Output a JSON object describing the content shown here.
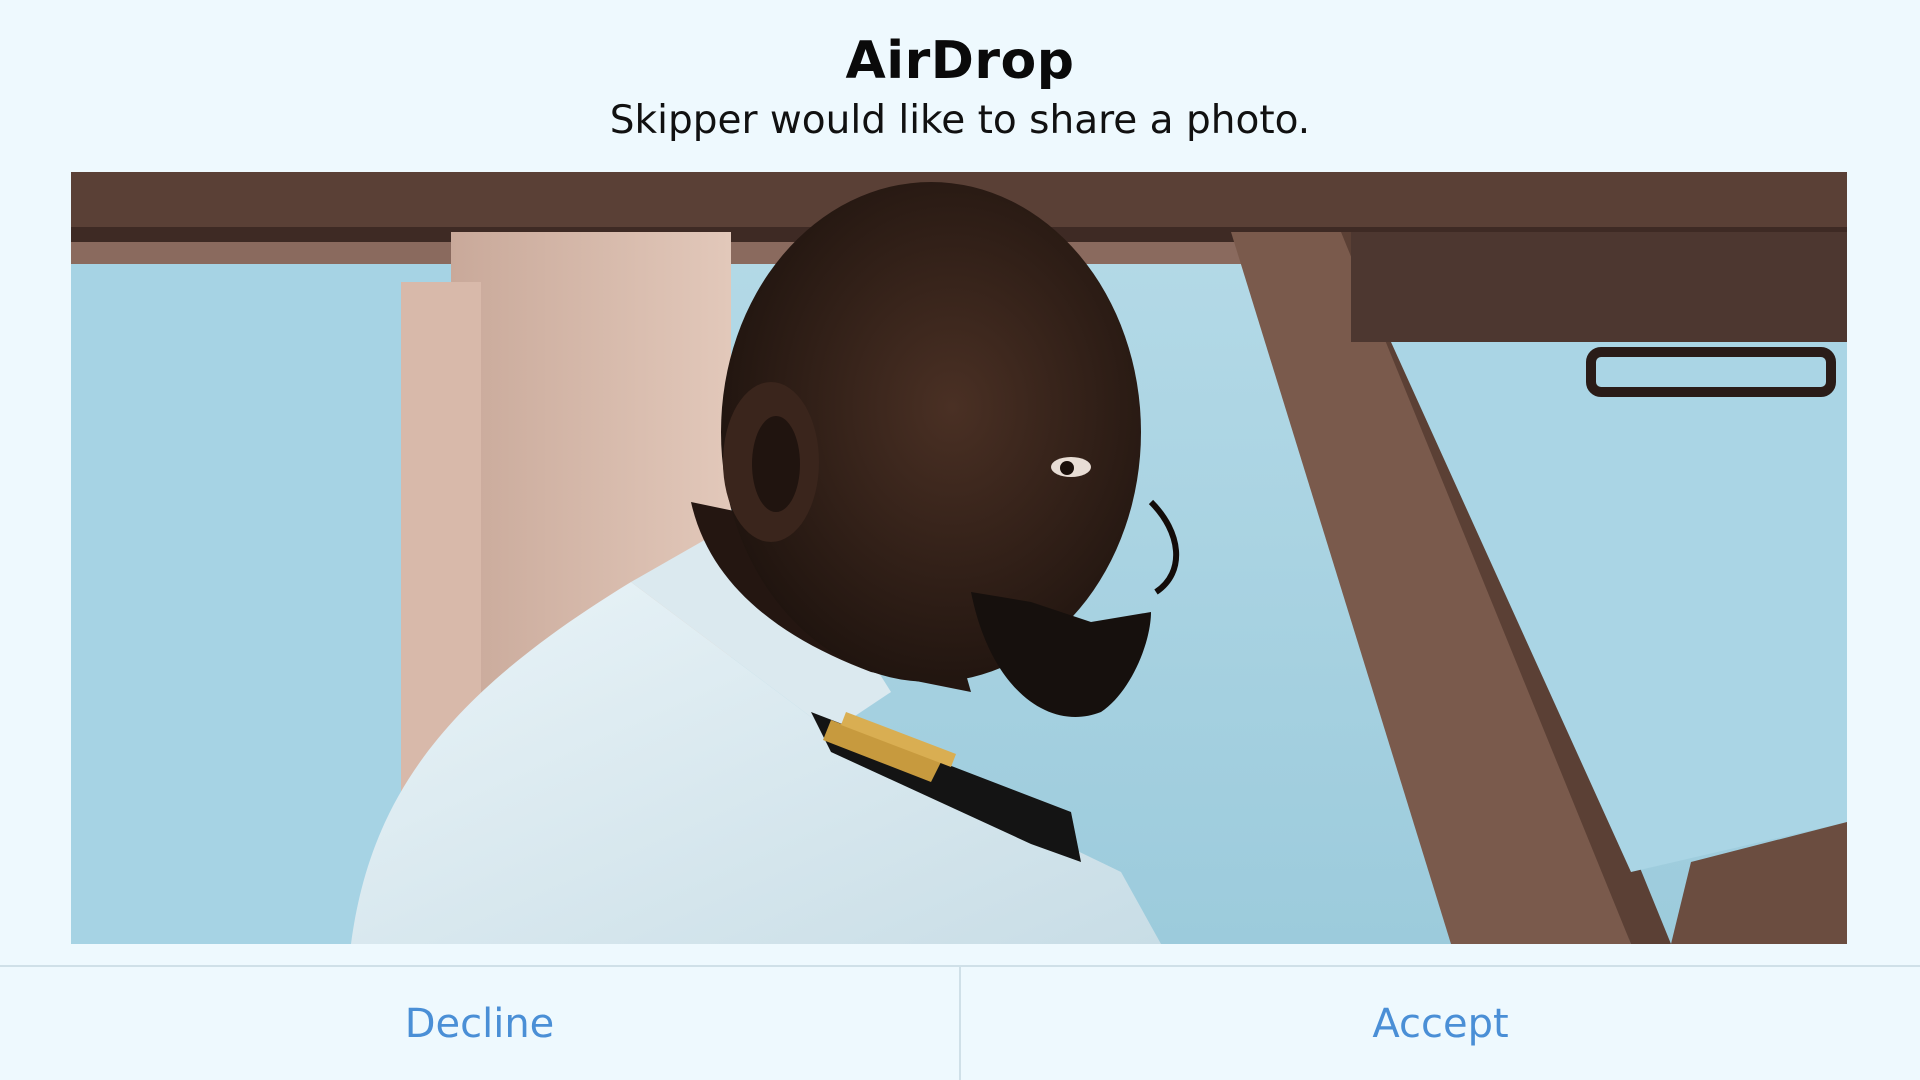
{
  "dialog": {
    "title": "AirDrop",
    "subtitle": "Skipper would like to share a photo.",
    "photo_alt": "Photo of a pilot in a cockpit"
  },
  "buttons": {
    "decline_label": "Decline",
    "accept_label": "Accept"
  },
  "colors": {
    "background": "#eef9fe",
    "button_text": "#4a8fd6",
    "divider": "#cfe0e8"
  }
}
